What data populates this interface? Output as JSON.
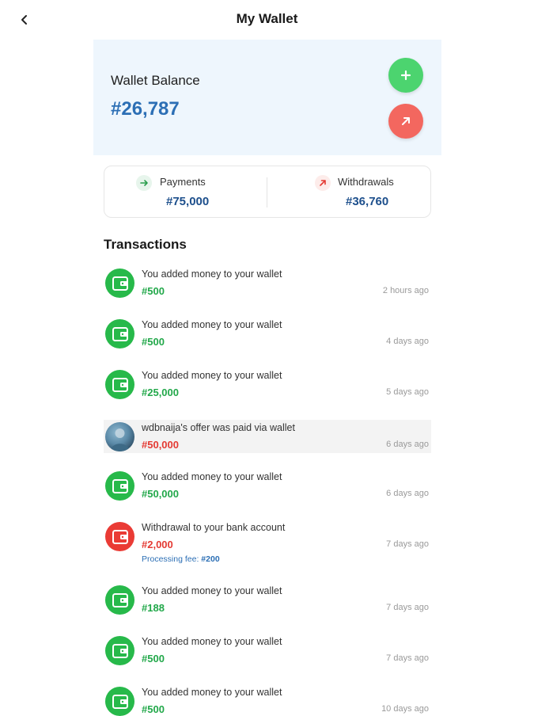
{
  "header": {
    "title": "My Wallet",
    "back_icon": "chevron-left-icon"
  },
  "balance": {
    "label": "Wallet Balance",
    "value": "#26,787",
    "add_icon": "plus-icon",
    "withdraw_icon": "arrow-up-right-icon"
  },
  "stats": {
    "payments": {
      "label": "Payments",
      "value": "#75,000",
      "icon": "arrow-right-icon"
    },
    "withdrawals": {
      "label": "Withdrawals",
      "value": "#36,760",
      "icon": "arrow-up-right-icon"
    }
  },
  "transactions": {
    "title": "Transactions",
    "items": [
      {
        "desc": "You added money to your wallet",
        "amount": "#500",
        "time": "2 hours ago",
        "type": "credit"
      },
      {
        "desc": "You added money to your wallet",
        "amount": "#500",
        "time": "4 days ago",
        "type": "credit"
      },
      {
        "desc": "You added money to your wallet",
        "amount": "#25,000",
        "time": "5 days ago",
        "type": "credit"
      },
      {
        "desc": "wdbnaija's offer was paid via wallet",
        "amount": "#50,000",
        "time": "6 days ago",
        "type": "payment"
      },
      {
        "desc": "You added money to your wallet",
        "amount": "#50,000",
        "time": "6 days ago",
        "type": "credit"
      },
      {
        "desc": "Withdrawal to your bank account",
        "amount": "#2,000",
        "time": "7 days ago",
        "type": "withdrawal",
        "fee_label": "Processing fee:",
        "fee_value": "#200"
      },
      {
        "desc": "You added money to your wallet",
        "amount": "#188",
        "time": "7 days ago",
        "type": "credit"
      },
      {
        "desc": "You added money to your wallet",
        "amount": "#500",
        "time": "7 days ago",
        "type": "credit"
      },
      {
        "desc": "You added money to your wallet",
        "amount": "#500",
        "time": "10 days ago",
        "type": "credit"
      }
    ]
  },
  "colors": {
    "brand_blue": "#2c6fb5",
    "credit_green": "#22a84a",
    "debit_red": "#e43a33",
    "add_button": "#4cd46f",
    "withdraw_button": "#f3675f",
    "card_background": "#eef6fd"
  }
}
